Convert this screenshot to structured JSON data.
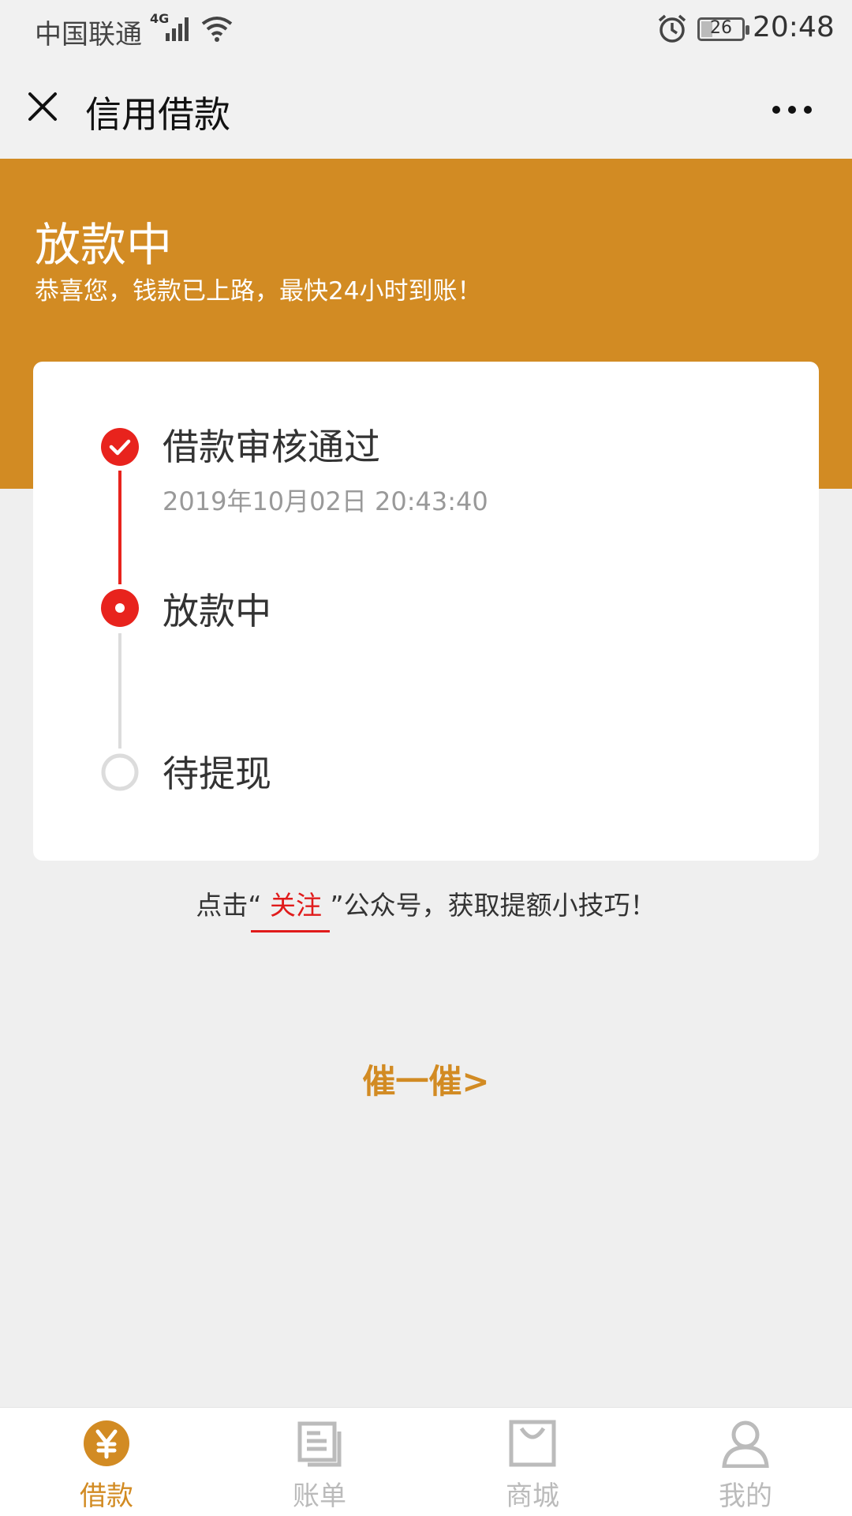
{
  "status_bar": {
    "carrier": "中国联通",
    "network": "4G",
    "battery": "26",
    "time": "20:48"
  },
  "header": {
    "title": "信用借款",
    "close_icon": "close-icon",
    "more_icon": "more-icon"
  },
  "banner": {
    "title": "放款中",
    "subtitle": "恭喜您，钱款已上路，最快24小时到账！"
  },
  "steps": [
    {
      "title": "借款审核通过",
      "time": "2019年10月02日 20:43:40",
      "state": "done"
    },
    {
      "title": "放款中",
      "time": "",
      "state": "current"
    },
    {
      "title": "待提现",
      "time": "",
      "state": "pending"
    }
  ],
  "tip": {
    "prefix": "点击“",
    "link": " 关注 ",
    "suffix": "”公众号，获取提额小技巧！"
  },
  "urge": {
    "label": "催一催>"
  },
  "tabbar": {
    "items": [
      {
        "label": "借款",
        "icon": "yen-icon",
        "active": true
      },
      {
        "label": "账单",
        "icon": "bill-icon",
        "active": false
      },
      {
        "label": "商城",
        "icon": "shop-icon",
        "active": false
      },
      {
        "label": "我的",
        "icon": "user-icon",
        "active": false
      }
    ]
  },
  "colors": {
    "accent": "#d28b23",
    "progress_red": "#e8231d",
    "inactive": "#cfcfcf"
  }
}
